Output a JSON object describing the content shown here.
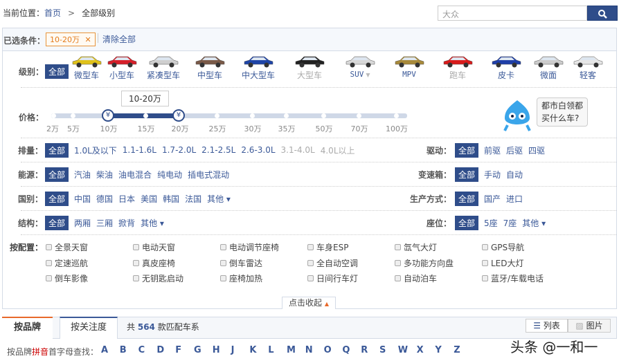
{
  "breadcrumb": {
    "prefix": "当前位置：",
    "home": "首页",
    "sep": ">",
    "current": "全部级别"
  },
  "search": {
    "value": "大众"
  },
  "selected": {
    "label": "已选条件：",
    "tag": "10-20万",
    "clear": "清除全部"
  },
  "level": {
    "label": "级别：",
    "all": "全部",
    "cars": [
      {
        "name": "微型车",
        "color": "#e0c21a"
      },
      {
        "name": "小型车",
        "color": "#d6202a"
      },
      {
        "name": "紧凑型车",
        "color": "#cfcfcf"
      },
      {
        "name": "中型车",
        "color": "#7a5a48"
      },
      {
        "name": "中大型车",
        "color": "#1f45a8"
      },
      {
        "name": "大型车",
        "color": "#222222",
        "disabled": true
      },
      {
        "name": "SUV",
        "color": "#d8d8d8",
        "dropdown": true
      },
      {
        "name": "MPV",
        "color": "#a88a3a"
      },
      {
        "name": "跑车",
        "color": "#d81c1c",
        "disabled": true
      },
      {
        "name": "皮卡",
        "color": "#1f3fa8"
      },
      {
        "name": "微面",
        "color": "#cccccc"
      },
      {
        "name": "轻客",
        "color": "#e6e6e6"
      }
    ]
  },
  "price": {
    "label": "价格：",
    "bubble": "10-20万",
    "ticks": [
      "2万",
      "5万",
      "10万",
      "15万",
      "20万",
      "25万",
      "30万",
      "35万",
      "50万",
      "70万",
      "100万"
    ],
    "range": [
      "10万",
      "20万"
    ],
    "knob": "¥"
  },
  "mascot": {
    "text1": "都市白领都",
    "text2": "买什么车?"
  },
  "filters": [
    {
      "label": "排量：",
      "all": "全部",
      "options": [
        "1.0L及以下",
        "1.1-1.6L",
        "1.7-2.0L",
        "2.1-2.5L",
        "2.6-3.0L",
        "3.1-4.0L",
        "4.0L以上"
      ],
      "disabled": [
        5,
        6
      ],
      "rlabel": "驱动：",
      "rall": "全部",
      "roptions": [
        "前驱",
        "后驱",
        "四驱"
      ]
    },
    {
      "label": "能源：",
      "all": "全部",
      "options": [
        "汽油",
        "柴油",
        "油电混合",
        "纯电动",
        "插电式混动"
      ],
      "rlabel": "变速箱：",
      "rall": "全部",
      "roptions": [
        "手动",
        "自动"
      ]
    },
    {
      "label": "国别：",
      "all": "全部",
      "options": [
        "中国",
        "德国",
        "日本",
        "美国",
        "韩国",
        "法国",
        "其他 ▾"
      ],
      "rlabel": "生产方式：",
      "rall": "全部",
      "roptions": [
        "国产",
        "进口"
      ]
    },
    {
      "label": "结构：",
      "all": "全部",
      "options": [
        "两厢",
        "三厢",
        "掀背",
        "其他 ▾"
      ],
      "rlabel": "座位：",
      "rall": "全部",
      "roptions": [
        "5座",
        "7座",
        "其他 ▾"
      ]
    }
  ],
  "config": {
    "label": "按配置：",
    "items": [
      "全景天窗",
      "电动天窗",
      "电动调节座椅",
      "车身ESP",
      "氙气大灯",
      "GPS导航",
      "定速巡航",
      "真皮座椅",
      "倒车雷达",
      "全自动空调",
      "多功能方向盘",
      "LED大灯",
      "倒车影像",
      "无钥匙启动",
      "座椅加热",
      "日间行车灯",
      "自动泊车",
      "蓝牙/车载电话"
    ]
  },
  "collapse": "点击收起",
  "tabs": {
    "brand": "按品牌",
    "attention": "按关注度",
    "count_pre": "共",
    "count": "564",
    "count_post": "款匹配车系",
    "list": "列表",
    "image": "图片"
  },
  "letters": {
    "label_pre": "按品牌",
    "label_hl": "拼音",
    "label_post": "首字母查找：",
    "items": [
      "A",
      "B",
      "C",
      "D",
      "F",
      "G",
      "H",
      "J",
      "K",
      "L",
      "M",
      "N",
      "O",
      "Q",
      "R",
      "S",
      "W",
      "X",
      "Y",
      "Z"
    ]
  },
  "watermark": "头条 @一和一"
}
